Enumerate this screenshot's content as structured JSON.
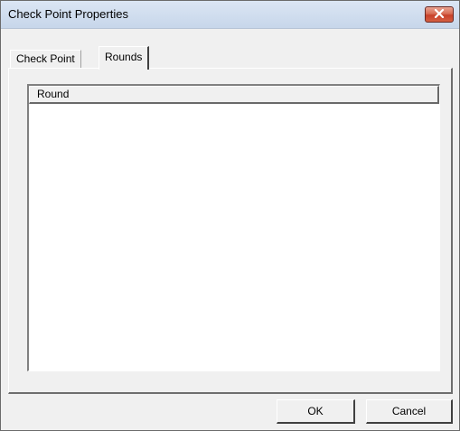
{
  "window": {
    "title": "Check Point Properties",
    "close_icon": "close-icon"
  },
  "tabs": [
    {
      "label": "Check Point",
      "active": false
    },
    {
      "label": "Rounds",
      "active": true
    }
  ],
  "list": {
    "columns": [
      "Round"
    ],
    "rows": []
  },
  "buttons": {
    "ok_label": "OK",
    "cancel_label": "Cancel"
  },
  "colors": {
    "close_button": "#c8412a",
    "dialog_background": "#f0f0f0"
  }
}
